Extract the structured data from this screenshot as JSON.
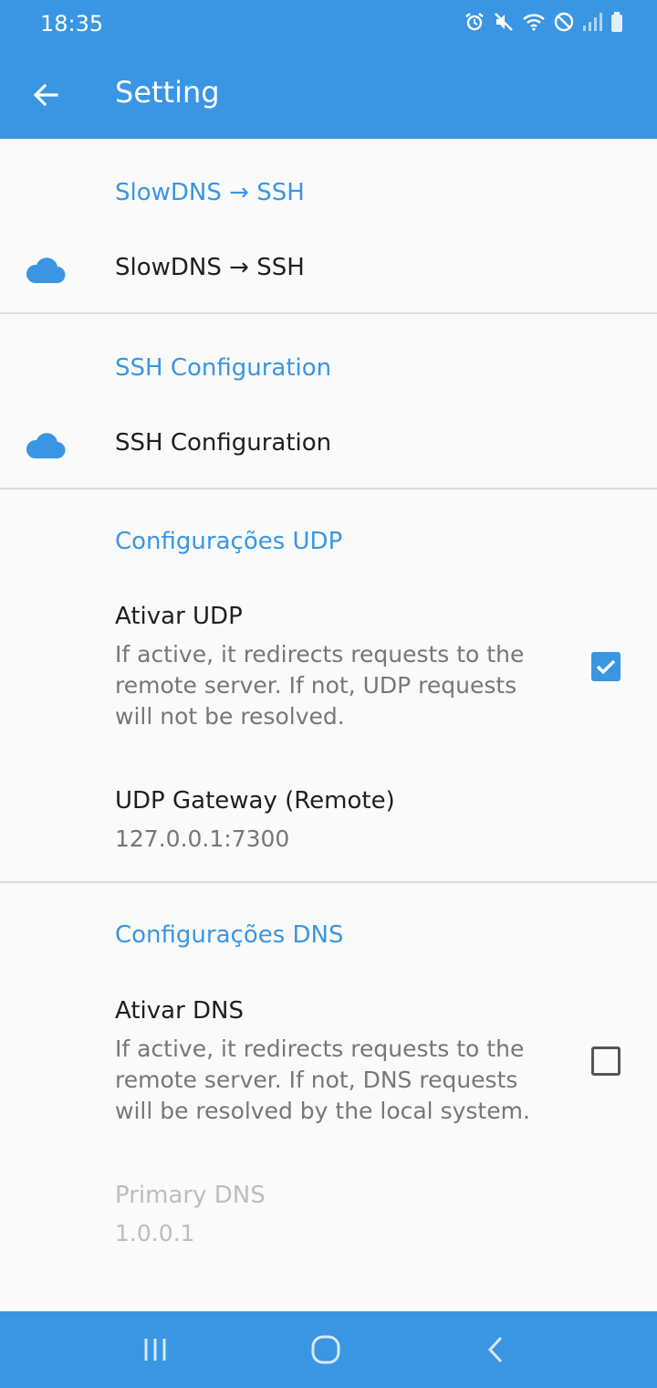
{
  "status_bar": {
    "time": "18:35",
    "icons": [
      "alarm-icon",
      "mute-icon",
      "wifi-icon",
      "do-not-disturb-icon",
      "signal-icon",
      "battery-icon"
    ]
  },
  "app_bar": {
    "title": "Setting",
    "back_icon": "arrow-left-icon"
  },
  "sections": {
    "slowdns": {
      "category": "SlowDNS → SSH",
      "item_title": "SlowDNS → SSH"
    },
    "ssh": {
      "category": "SSH Configuration",
      "item_title": "SSH Configuration"
    },
    "udp": {
      "category": "Configurações UDP",
      "enable_title": "Ativar UDP",
      "enable_summary": "If active, it redirects requests to the remote server. If not, UDP requests will not be resolved.",
      "enable_checked": true,
      "gateway_title": "UDP Gateway (Remote)",
      "gateway_value": "127.0.0.1:7300"
    },
    "dns": {
      "category": "Configurações DNS",
      "enable_title": "Ativar DNS",
      "enable_summary": "If active, it redirects requests to the remote server. If not, DNS requests will be resolved by the local system.",
      "enable_checked": false,
      "primary_title": "Primary DNS",
      "primary_value": "1.0.0.1"
    }
  },
  "nav_bar": {
    "buttons": [
      "recent-apps-icon",
      "home-icon",
      "back-icon"
    ]
  },
  "colors": {
    "accent": "#3a96e2",
    "background": "#fafafa",
    "text_primary": "#1f1f1f",
    "text_secondary": "#777777",
    "text_disabled": "#bdbdbd"
  }
}
